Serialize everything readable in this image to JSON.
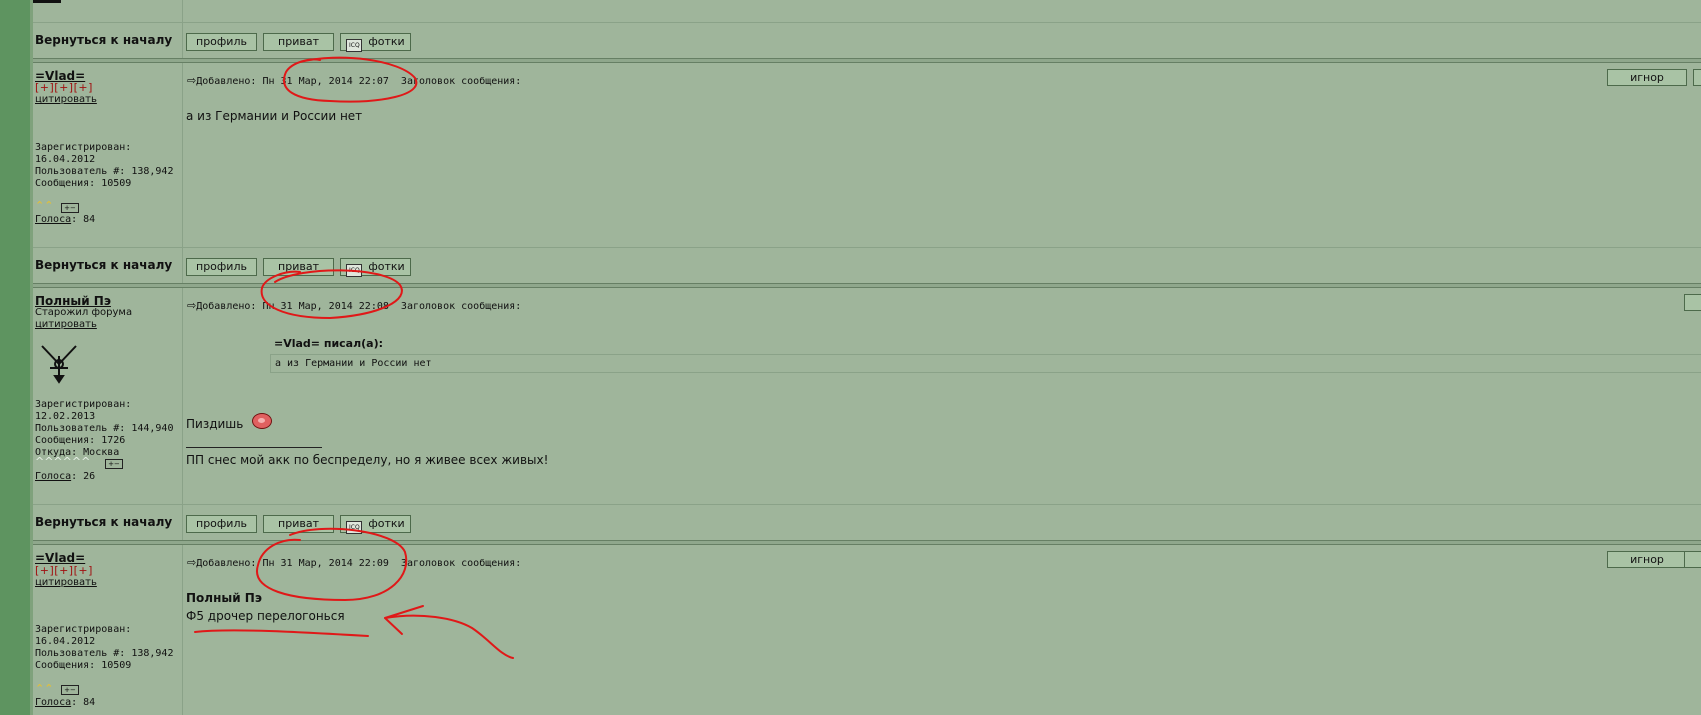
{
  "nav": {
    "back_to_top": "Вернуться к началу",
    "profile": "профиль",
    "private": "приват",
    "photos": "фотки",
    "photos_icon": "ICQ",
    "ignore": "игнор"
  },
  "posts": [
    {
      "author": "=Vlad=",
      "rank": "[+][+][+]",
      "quote_link": "цитировать",
      "registered_label": "Зарегистрирован:",
      "registered": "16.04.2012",
      "user_no": "Пользователь #: 138,942",
      "messages": "Сообщения: 10509",
      "votes_label": "Голоса",
      "votes": ": 84",
      "posted": "Добавлено: Пн 31 Мар, 2014 22:07",
      "subject": "Заголовок сообщения:",
      "text": "а из Германии и России нет"
    },
    {
      "author": "Полный Пэ",
      "rank": "Старожил форума",
      "quote_link": "цитировать",
      "registered_label": "Зарегистрирован:",
      "registered": "12.02.2013",
      "user_no": "Пользователь #: 144,940",
      "messages": "Сообщения: 1726",
      "location": "Откуда: Москва",
      "votes_label": "Голоса",
      "votes": ": 26",
      "posted": "Добавлено: Пн 31 Мар, 2014 22:08",
      "subject": "Заголовок сообщения:",
      "quote_author": "=Vlad= писал(а):",
      "quote_text": "а из Германии и России нет",
      "text": "Пиздишь",
      "signature_line": "____________________",
      "signature": "ПП снес мой акк по беспределу, но я живее всех живых!"
    },
    {
      "author": "=Vlad=",
      "rank": "[+][+][+]",
      "quote_link": "цитировать",
      "registered_label": "Зарегистрирован:",
      "registered": "16.04.2012",
      "user_no": "Пользователь #: 138,942",
      "messages": "Сообщения: 10509",
      "votes_label": "Голоса",
      "votes": ": 84",
      "posted": "Добавлено: Пн 31 Мар, 2014 22:09",
      "subject": "Заголовок сообщения:",
      "mention": "Полный Пэ",
      "text": "Ф5 дрочер перелогонься"
    }
  ],
  "colors": {
    "background": "#9fb59b",
    "gutter": "#5e9460",
    "annotation": "#e01818"
  }
}
